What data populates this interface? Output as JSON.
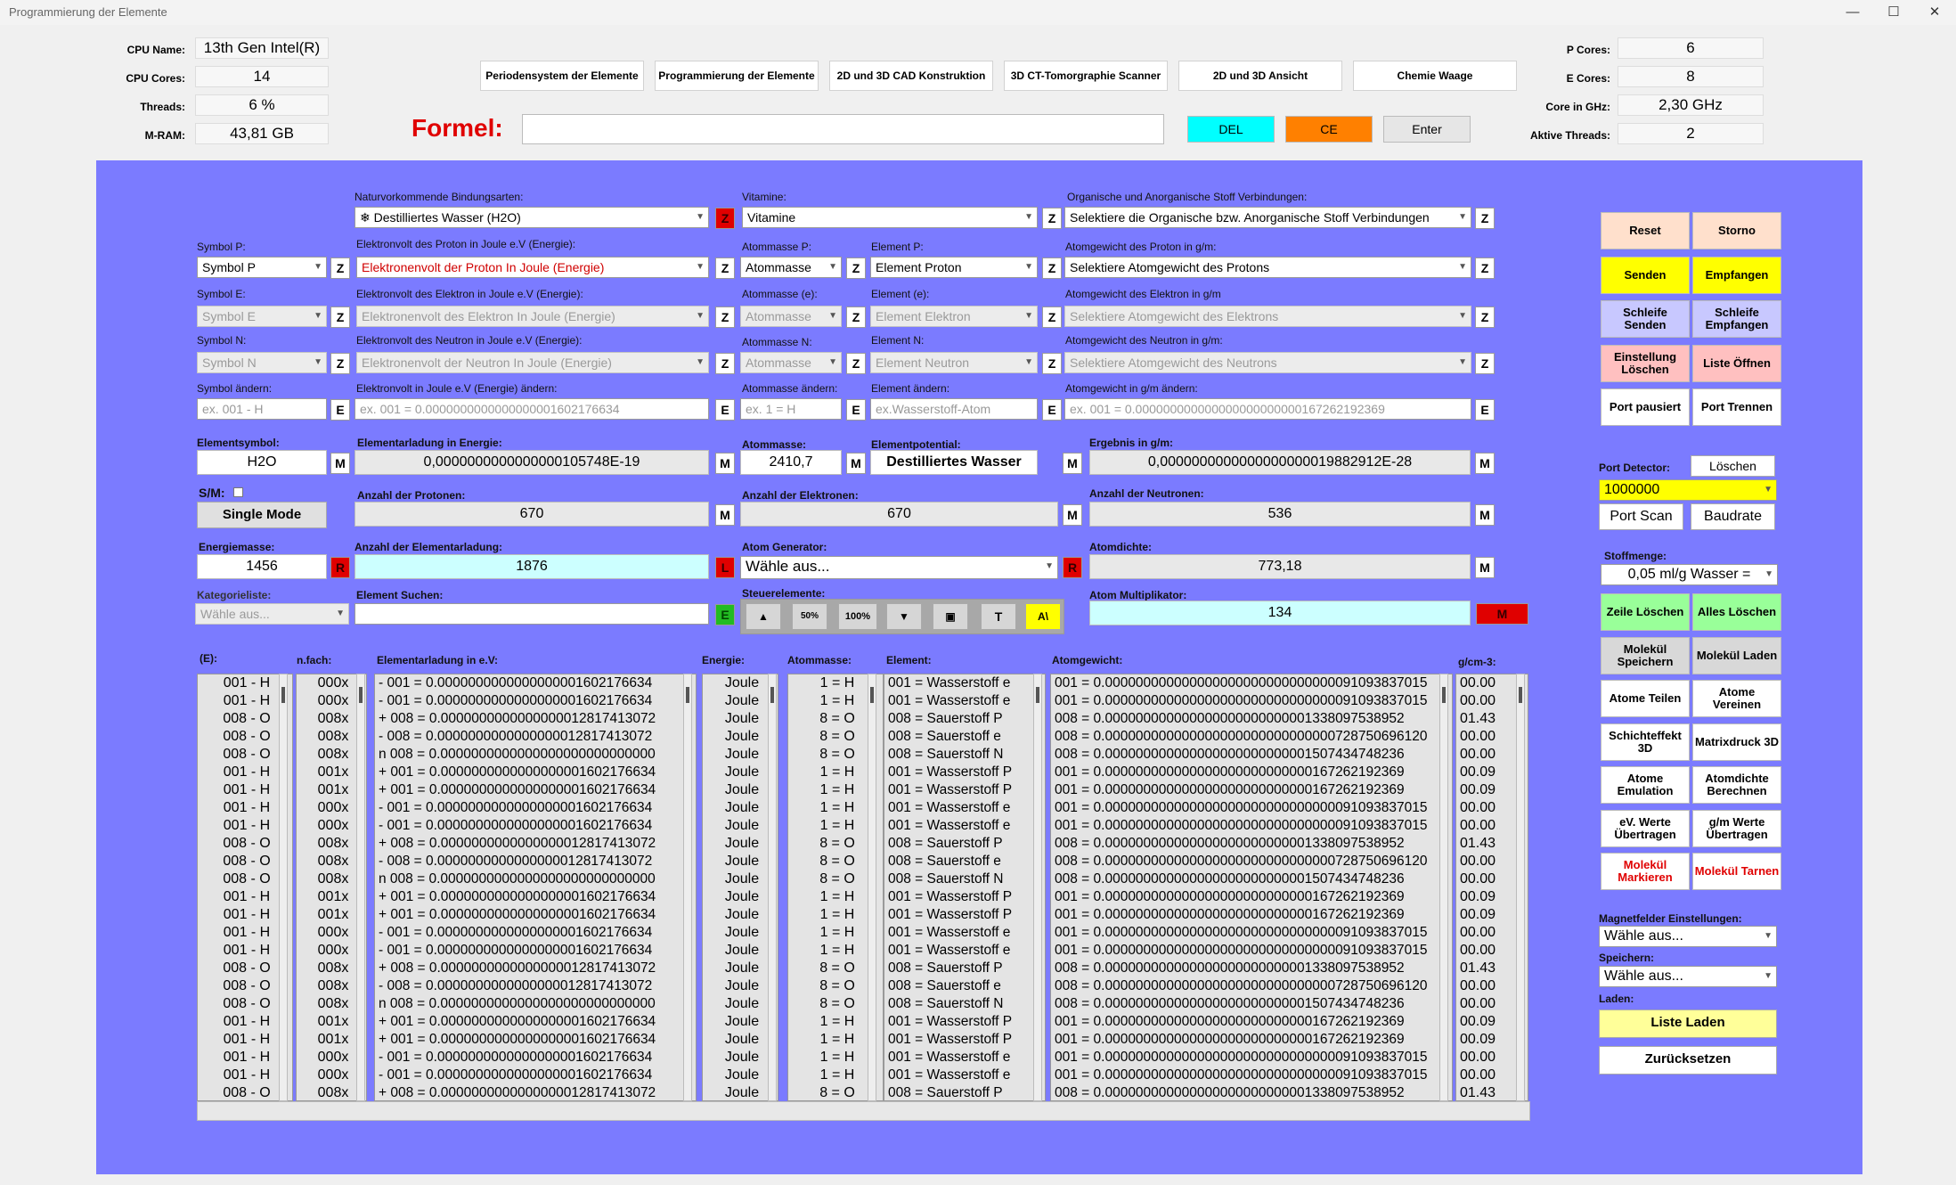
{
  "window": {
    "title": "Programmierung der Elemente",
    "minimize": "—",
    "maximize": "☐",
    "close": "✕"
  },
  "sysinfo": {
    "cpu_name_label": "CPU Name:",
    "cpu_name": "13th Gen Intel(R)",
    "cpu_cores_label": "CPU Cores:",
    "cpu_cores": "14",
    "threads_label": "Threads:",
    "threads": "6 %",
    "mram_label": "M-RAM:",
    "mram": "43,81 GB",
    "p_cores_label": "P Cores:",
    "p_cores": "6",
    "e_cores_label": "E Cores:",
    "e_cores": "8",
    "ghz_label": "Core in GHz:",
    "ghz": "2,30 GHz",
    "active_label": "Aktive Threads:",
    "active": "2"
  },
  "nav": [
    "Periodensystem der Elemente",
    "Programmierung der Elemente",
    "2D und 3D CAD Konstruktion",
    "3D CT-Tomorgraphie Scanner",
    "2D und 3D Ansicht",
    "Chemie Waage"
  ],
  "formel": {
    "label": "Formel:",
    "del": "DEL",
    "ce": "CE",
    "enter": "Enter",
    "color_del": "#00ffff",
    "color_ce": "#ff8000"
  },
  "panel_color": "#7b7bff",
  "form": {
    "bindung_label": "Naturvorkommende Bindungsarten:",
    "bindung": "Destilliertes Wasser (H2O)",
    "vitamine_label": "Vitamine:",
    "vitamine": "Vitamine",
    "organisch_label": "Organische und Anorganische Stoff Verbindungen:",
    "organisch": "Selektiere die Organische bzw. Anorganische Stoff Verbindungen",
    "symbol_p_label": "Symbol P:",
    "symbol_p": "Symbol P",
    "ev_p_label": "Elektronvolt des Proton in Joule e.V (Energie):",
    "ev_p": "Elektronenvolt der Proton In Joule (Energie)",
    "atommasse_p_label": "Atommasse P:",
    "atommasse_p": "Atommasse",
    "element_p_label": "Element P:",
    "element_p": "Element Proton",
    "gewicht_p_label": "Atomgewicht des Proton in g/m:",
    "gewicht_p": "Selektiere Atomgewicht des Protons",
    "symbol_e_label": "Symbol E:",
    "symbol_e": "Symbol E",
    "ev_e_label": "Elektronvolt des Elektron in Joule e.V (Energie):",
    "ev_e": "Elektronenvolt des Elektron In Joule (Energie)",
    "atommasse_e_label": "Atommasse (e):",
    "atommasse_e": "Atommasse",
    "element_e_label": "Element (e):",
    "element_e": "Element Elektron",
    "gewicht_e_label": "Atomgewicht des Elektron in g/m",
    "gewicht_e": "Selektiere Atomgewicht des Elektrons",
    "symbol_n_label": "Symbol N:",
    "symbol_n": "Symbol N",
    "ev_n_label": "Elektronvolt des Neutron in Joule e.V (Energie):",
    "ev_n": "Elektronenvolt der Neutron In Joule (Energie)",
    "atommasse_n_label": "Atommasse N:",
    "atommasse_n": "Atommasse",
    "element_n_label": "Element N:",
    "element_n": "Element Neutron",
    "gewicht_n_label": "Atomgewicht des Neutron in g/m:",
    "gewicht_n": "Selektiere Atomgewicht des Neutrons",
    "symbol_aendern_label": "Symbol ändern:",
    "symbol_aendern_ph": "ex. 001 - H",
    "ev_aendern_label": "Elektronvolt in Joule e.V (Energie) ändern:",
    "ev_aendern_ph": "ex. 001 = 0.0000000000000000001602176634",
    "atommasse_aendern_label": "Atommasse ändern:",
    "atommasse_aendern_ph": "ex.  1  =  H",
    "element_aendern_label": "Element ändern:",
    "element_aendern_ph": "ex.Wasserstoff-Atom",
    "gewicht_aendern_label": "Atomgewicht in g/m ändern:",
    "gewicht_aendern_ph": "ex. 001 = 0.000000000000000000000000167262192369",
    "elementsymbol_label": "Elementsymbol:",
    "elementsymbol": "H2O",
    "ladung_energie_label": "Elementarladung in Energie:",
    "ladung_energie": "0,0000000000000000105748E-19",
    "atommasse_label": "Atommasse:",
    "atommasse": "2410,7",
    "potential_label": "Elementpotential:",
    "potential": "Destilliertes Wasser",
    "ergebnis_label": "Ergebnis in g/m:",
    "ergebnis": "0,0000000000000000000019882912E-28",
    "sm_label": "S/M:",
    "single_mode": "Single Mode",
    "protonen_label": "Anzahl der Protonen:",
    "protonen": "670",
    "elektronen_label": "Anzahl der Elektronen:",
    "elektronen": "670",
    "neutronen_label": "Anzahl der Neutronen:",
    "neutronen": "536",
    "energiemasse_label": "Energiemasse:",
    "energiemasse": "1456",
    "elementarladung_label": "Anzahl der Elementarladung:",
    "elementarladung": "1876",
    "generator_label": "Atom Generator:",
    "generator": "Wähle aus...",
    "dichte_label": "Atomdichte:",
    "dichte": "773,18",
    "kategorie_label": "Kategorieliste:",
    "kategorie": "Wähle aus...",
    "suchen_label": "Element Suchen:",
    "suchen": "",
    "steuer_label": "Steuerelemente:",
    "steuer": [
      "▲",
      "50%",
      "100%",
      "▼",
      "▣",
      "T",
      "A\\"
    ],
    "multiplikator_label": "Atom Multiplikator:",
    "multiplikator": "134",
    "z": "Z",
    "e": "E",
    "m": "M",
    "r": "R",
    "l": "L"
  },
  "lists": {
    "headers": {
      "e": "(E):",
      "nfach": "n.fach:",
      "ladung": "Elementarladung in e.V:",
      "energie": "Energie:",
      "atommasse": "Atommasse:",
      "element": "Element:",
      "gewicht": "Atomgewicht:",
      "dichte": "g/cm-3:"
    },
    "e": [
      "001 - H",
      "001 - H",
      "008 - O",
      "008 - O",
      "008 - O",
      "001 - H",
      "001 - H",
      "001 - H",
      "001 - H",
      "008 - O",
      "008 - O",
      "008 - O",
      "001 - H",
      "001 - H",
      "001 - H",
      "001 - H",
      "008 - O",
      "008 - O",
      "008 - O",
      "001 - H",
      "001 - H",
      "001 - H",
      "001 - H",
      "008 - O"
    ],
    "nfach": [
      "000x",
      "000x",
      "008x",
      "008x",
      "008x",
      "001x",
      "001x",
      "000x",
      "000x",
      "008x",
      "008x",
      "008x",
      "001x",
      "001x",
      "000x",
      "000x",
      "008x",
      "008x",
      "008x",
      "001x",
      "001x",
      "000x",
      "000x",
      "008x"
    ],
    "ladung": [
      "- 001 = 0.0000000000000000001602176634",
      "- 001 = 0.0000000000000000001602176634",
      "+ 008 = 0.0000000000000000012817413072",
      "- 008 = 0.0000000000000000012817413072",
      "n 008 = 0.0000000000000000000000000000",
      "+ 001 = 0.0000000000000000001602176634",
      "+ 001 = 0.0000000000000000001602176634",
      "- 001 = 0.0000000000000000001602176634",
      "- 001 = 0.0000000000000000001602176634",
      "+ 008 = 0.0000000000000000012817413072",
      "- 008 = 0.0000000000000000012817413072",
      "n 008 = 0.0000000000000000000000000000",
      "+ 001 = 0.0000000000000000001602176634",
      "+ 001 = 0.0000000000000000001602176634",
      "- 001 = 0.0000000000000000001602176634",
      "- 001 = 0.0000000000000000001602176634",
      "+ 008 = 0.0000000000000000012817413072",
      "- 008 = 0.0000000000000000012817413072",
      "n 008 = 0.0000000000000000000000000000",
      "+ 001 = 0.0000000000000000001602176634",
      "+ 001 = 0.0000000000000000001602176634",
      "- 001 = 0.0000000000000000001602176634",
      "- 001 = 0.0000000000000000001602176634",
      "+ 008 = 0.0000000000000000012817413072"
    ],
    "energie": [
      "Joule",
      "Joule",
      "Joule",
      "Joule",
      "Joule",
      "Joule",
      "Joule",
      "Joule",
      "Joule",
      "Joule",
      "Joule",
      "Joule",
      "Joule",
      "Joule",
      "Joule",
      "Joule",
      "Joule",
      "Joule",
      "Joule",
      "Joule",
      "Joule",
      "Joule",
      "Joule",
      "Joule"
    ],
    "atommasse": [
      "1  =  H",
      "1  =  H",
      "8  =  O",
      "8  =  O",
      "8  =  O",
      "1  =  H",
      "1  =  H",
      "1  =  H",
      "1  =  H",
      "8  =  O",
      "8  =  O",
      "8  =  O",
      "1  =  H",
      "1  =  H",
      "1  =  H",
      "1  =  H",
      "8  =  O",
      "8  =  O",
      "8  =  O",
      "1  =  H",
      "1  =  H",
      "1  =  H",
      "1  =  H",
      "8  =  O"
    ],
    "element": [
      "001 = Wasserstoff e",
      "001 = Wasserstoff e",
      "008 = Sauerstoff P",
      "008 = Sauerstoff e",
      "008 = Sauerstoff N",
      "001 = Wasserstoff P",
      "001 = Wasserstoff P",
      "001 = Wasserstoff e",
      "001 = Wasserstoff e",
      "008 = Sauerstoff P",
      "008 = Sauerstoff e",
      "008 = Sauerstoff N",
      "001 = Wasserstoff P",
      "001 = Wasserstoff P",
      "001 = Wasserstoff e",
      "001 = Wasserstoff e",
      "008 = Sauerstoff P",
      "008 = Sauerstoff e",
      "008 = Sauerstoff N",
      "001 = Wasserstoff P",
      "001 = Wasserstoff P",
      "001 = Wasserstoff e",
      "001 = Wasserstoff e",
      "008 = Sauerstoff P"
    ],
    "gewicht": [
      "001 = 0.000000000000000000000000000000091093837015",
      "001 = 0.000000000000000000000000000000091093837015",
      "008 = 0.000000000000000000000000001338097538952",
      "008 = 0.000000000000000000000000000000728750696120",
      "008 = 0.000000000000000000000000001507434748236",
      "001 = 0.000000000000000000000000000167262192369",
      "001 = 0.000000000000000000000000000167262192369",
      "001 = 0.000000000000000000000000000000091093837015",
      "001 = 0.000000000000000000000000000000091093837015",
      "008 = 0.000000000000000000000000001338097538952",
      "008 = 0.000000000000000000000000000000728750696120",
      "008 = 0.000000000000000000000000001507434748236",
      "001 = 0.000000000000000000000000000167262192369",
      "001 = 0.000000000000000000000000000167262192369",
      "001 = 0.000000000000000000000000000000091093837015",
      "001 = 0.000000000000000000000000000000091093837015",
      "008 = 0.000000000000000000000000001338097538952",
      "008 = 0.000000000000000000000000000000728750696120",
      "008 = 0.000000000000000000000000001507434748236",
      "001 = 0.000000000000000000000000000167262192369",
      "001 = 0.000000000000000000000000000167262192369",
      "001 = 0.000000000000000000000000000000091093837015",
      "001 = 0.000000000000000000000000000000091093837015",
      "008 = 0.000000000000000000000000001338097538952"
    ],
    "dichte": [
      "00.00",
      "00.00",
      "01.43",
      "00.00",
      "00.00",
      "00.09",
      "00.09",
      "00.00",
      "00.00",
      "01.43",
      "00.00",
      "00.00",
      "00.09",
      "00.09",
      "00.00",
      "00.00",
      "01.43",
      "00.00",
      "00.00",
      "00.09",
      "00.09",
      "00.00",
      "00.00",
      "01.43"
    ]
  },
  "right": {
    "buttons": [
      {
        "label": "Reset",
        "bg": "#ffe0cc",
        "color": "#000"
      },
      {
        "label": "Storno",
        "bg": "#ffe0cc",
        "color": "#000"
      },
      {
        "label": "Senden",
        "bg": "#ffff00",
        "color": "#000"
      },
      {
        "label": "Empfangen",
        "bg": "#ffff00",
        "color": "#000"
      },
      {
        "label": "Schleife Senden",
        "bg": "#c8c8ff",
        "color": "#000"
      },
      {
        "label": "Schleife Empfangen",
        "bg": "#c8c8ff",
        "color": "#000"
      },
      {
        "label": "Einstellung Löschen",
        "bg": "#ffc0c0",
        "color": "#000"
      },
      {
        "label": "Liste Öffnen",
        "bg": "#ffc0c0",
        "color": "#000"
      },
      {
        "label": "Port pausiert",
        "bg": "#ffffff",
        "color": "#000"
      },
      {
        "label": "Port Trennen",
        "bg": "#ffffff",
        "color": "#000"
      }
    ],
    "port_detector_label": "Port Detector:",
    "loeschen": "Löschen",
    "port_value": "1000000",
    "port_scan": "Port Scan",
    "baudrate": "Baudrate",
    "stoffmenge_label": "Stoffmenge:",
    "stoffmenge": "0,05 ml/g Wasser =",
    "buttons2": [
      {
        "label": "Zeile Löschen",
        "bg": "#99ff99",
        "color": "#000"
      },
      {
        "label": "Alles Löschen",
        "bg": "#99ff99",
        "color": "#000"
      },
      {
        "label": "Molekül Speichern",
        "bg": "#d8d8d8",
        "color": "#000"
      },
      {
        "label": "Molekül Laden",
        "bg": "#d8d8d8",
        "color": "#000"
      },
      {
        "label": "Atome Teilen",
        "bg": "#ffffff",
        "color": "#000"
      },
      {
        "label": "Atome Vereinen",
        "bg": "#ffffff",
        "color": "#000"
      },
      {
        "label": "Schichteffekt 3D",
        "bg": "#ffffff",
        "color": "#000"
      },
      {
        "label": "Matrixdruck 3D",
        "bg": "#ffffff",
        "color": "#000"
      },
      {
        "label": "Atome Emulation",
        "bg": "#ffffff",
        "color": "#000"
      },
      {
        "label": "Atomdichte Berechnen",
        "bg": "#ffffff",
        "color": "#000"
      },
      {
        "label": "eV. Werte Übertragen",
        "bg": "#ffffff",
        "color": "#000"
      },
      {
        "label": "g/m Werte Übertragen",
        "bg": "#ffffff",
        "color": "#000"
      },
      {
        "label": "Molekül Markieren",
        "bg": "#ffffff",
        "color": "#e00000"
      },
      {
        "label": "Molekül Tarnen",
        "bg": "#ffffff",
        "color": "#e00000"
      }
    ],
    "magnet_label": "Magnetfelder Einstellungen:",
    "magnet": "Wähle aus...",
    "speichern_label": "Speichern:",
    "speichern": "Wähle aus...",
    "laden_label": "Laden:",
    "liste_laden": "Liste Laden",
    "zuruecksetzen": "Zurücksetzen"
  }
}
